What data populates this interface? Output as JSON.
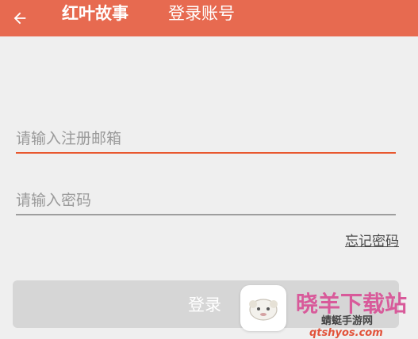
{
  "header": {
    "app_title": "红叶故事",
    "page_title": "登录账号",
    "back_icon": "back-arrow-icon"
  },
  "form": {
    "email_placeholder": "请输入注册邮箱",
    "email_value": "",
    "password_placeholder": "请输入密码",
    "password_value": "",
    "forgot_password_label": "忘记密码",
    "login_label": "登录"
  },
  "watermark": {
    "site_name": "晓羊下载站",
    "tagline": "蜻蜓手游网",
    "url": "qtshyos.com"
  },
  "colors": {
    "header_bg": "#e76a50",
    "active_underline": "#e8572e",
    "button_disabled_bg": "#d6d6d6"
  }
}
